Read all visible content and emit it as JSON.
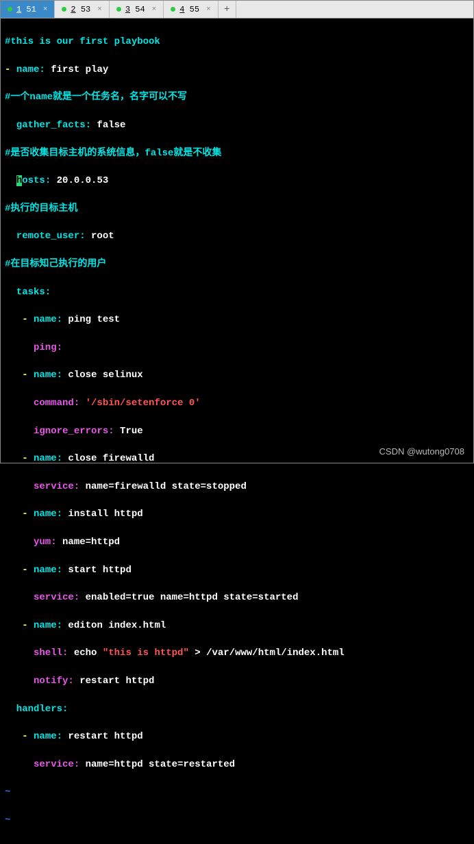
{
  "tabs": [
    {
      "dot": true,
      "underline_char": "1",
      "rest": " 51",
      "active": true
    },
    {
      "dot": true,
      "underline_char": "2",
      "rest": " 53",
      "active": false
    },
    {
      "dot": true,
      "underline_char": "3",
      "rest": " 54",
      "active": false
    },
    {
      "dot": true,
      "underline_char": "4",
      "rest": " 55",
      "active": false
    }
  ],
  "new_tab_label": "+",
  "code": {
    "l0": "#this is our first playbook",
    "l1_name": "- name:",
    "l1_val": " first play",
    "l2": "#一个name就是一个任务名，名字可以不写",
    "l3_key": "  gather_facts:",
    "l3_val": " false",
    "l4": "#是否收集目标主机的系统信息，false就是不收集",
    "l5_pre": "  ",
    "l5_cur": "h",
    "l5_key": "osts:",
    "l5_val": " 20.0.0.53",
    "l6": "#执行的目标主机",
    "l7_key": "  remote_user:",
    "l7_val": " root",
    "l8": "#在目标知己执行的用户",
    "l9_key": "  tasks:",
    "l10_dash": "   - ",
    "l10_key": "name:",
    "l10_val": " ping test",
    "l11_key": "     ping:",
    "l12_dash": "   - ",
    "l12_key": "name:",
    "l12_val": " close selinux",
    "l13_key": "     command:",
    "l13_val": " '/sbin/setenforce 0'",
    "l14_key": "     ignore_errors:",
    "l14_val": " True",
    "l15_dash": "   - ",
    "l15_key": "name:",
    "l15_val": " close firewalld",
    "l16_key": "     service:",
    "l16_val": " name=firewalld state=stopped",
    "l17_dash": "   - ",
    "l17_key": "name:",
    "l17_val": " install httpd",
    "l18_key": "     yum:",
    "l18_val": " name=httpd",
    "l19_dash": "   - ",
    "l19_key": "name:",
    "l19_val": " start httpd",
    "l20_key": "     service:",
    "l20_val": " enabled=true name=httpd state=started",
    "l21_dash": "   - ",
    "l21_key": "name:",
    "l21_val": " editon index.html",
    "l22_key": "     shell:",
    "l22_mid": " echo ",
    "l22_str": "\"this is httpd\"",
    "l22_end": " > /var/www/html/index.html",
    "l23_key": "     notify:",
    "l23_val": " restart httpd",
    "l24_key": "  handlers:",
    "l25_dash": "   - ",
    "l25_key": "name:",
    "l25_val": " restart httpd",
    "l26_key": "     service:",
    "l26_val": " name=httpd state=restarted",
    "tilde": "~"
  },
  "watermark": "CSDN @wutong0708"
}
